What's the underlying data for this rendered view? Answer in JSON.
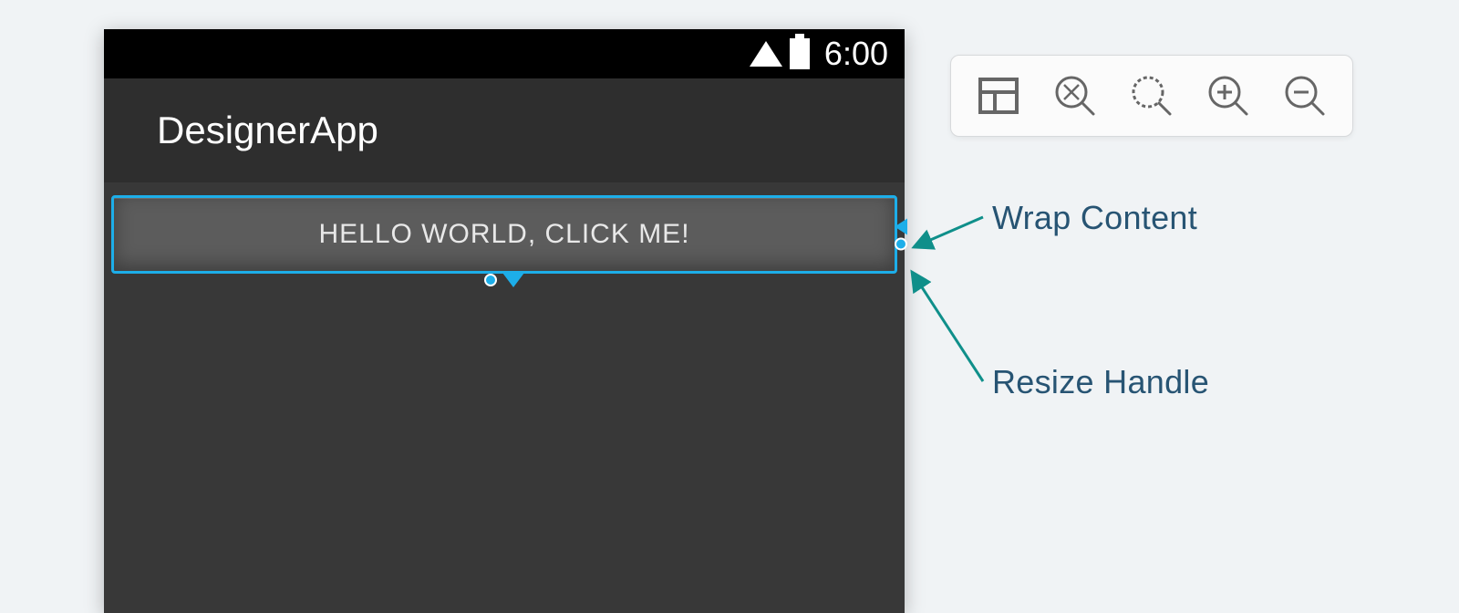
{
  "statusBar": {
    "time": "6:00"
  },
  "app": {
    "title": "DesignerApp"
  },
  "button": {
    "label": "HELLO WORLD, CLICK ME!"
  },
  "callouts": {
    "wrapContent": "Wrap Content",
    "resizeHandle": "Resize Handle"
  },
  "toolbar": {
    "surfaceMode": "layout-grid-icon",
    "zoomFit": "zoom-fit-icon",
    "zoomActual": "zoom-actual-icon",
    "zoomIn": "zoom-in-icon",
    "zoomOut": "zoom-out-icon"
  },
  "colors": {
    "selection": "#1daee9",
    "surface": "#383838",
    "appBar": "#2e2e2e",
    "buttonFace": "#5c5c5c",
    "callout": "#275473",
    "arrow": "#0f8f8a"
  }
}
